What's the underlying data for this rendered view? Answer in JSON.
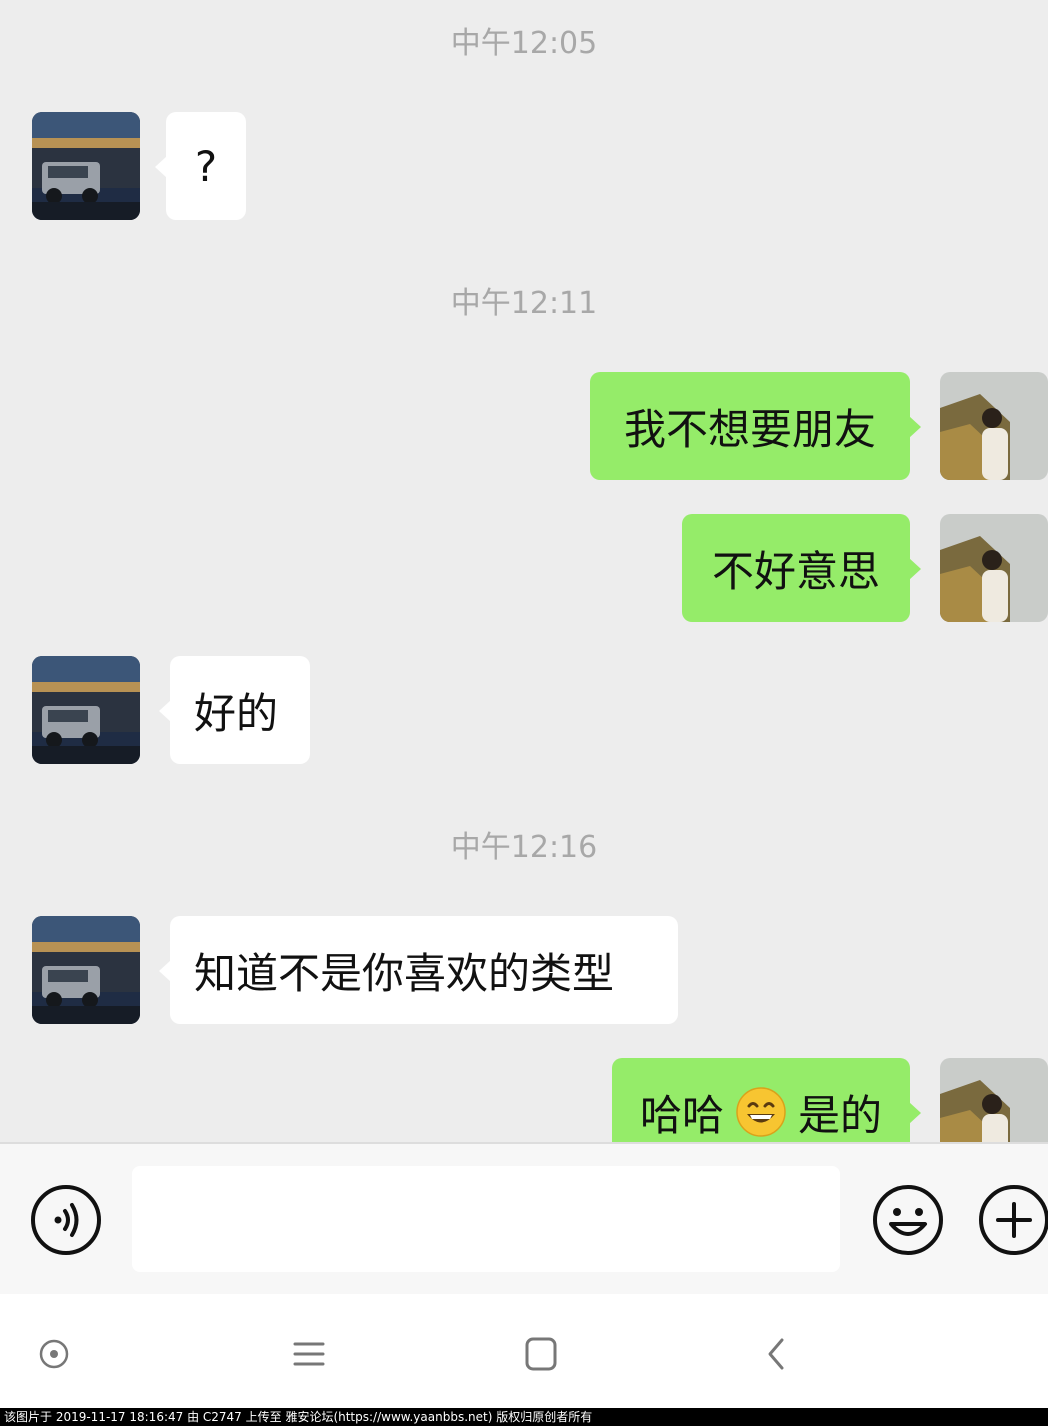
{
  "messages": {
    "ts1": "中午12:05",
    "m1": "?",
    "ts2": "中午12:11",
    "m2": "我不想要朋友",
    "m3": "不好意思",
    "m4": "好的",
    "ts3": "中午12:16",
    "m5": "知道不是你喜欢的类型",
    "m6_a": "哈哈",
    "m6_emoji": "grinning-face-emoji",
    "m6_b": "是的"
  },
  "input": {
    "placeholder": ""
  },
  "icons": {
    "voice": "voice-icon",
    "emoji": "emoji-icon",
    "plus": "plus-icon",
    "nav_circle": "nav-dot-icon",
    "nav_menu": "nav-menu-icon",
    "nav_home": "nav-home-icon",
    "nav_back": "nav-back-icon"
  },
  "colors": {
    "background": "#ededed",
    "outgoing": "#95ec69",
    "incoming": "#ffffff",
    "timestamp": "#a8a8a8"
  },
  "watermark": "该图片于 2019-11-17 18:16:47 由 C2747 上传至 雅安论坛(https://www.yaanbbs.net) 版权归原创者所有"
}
